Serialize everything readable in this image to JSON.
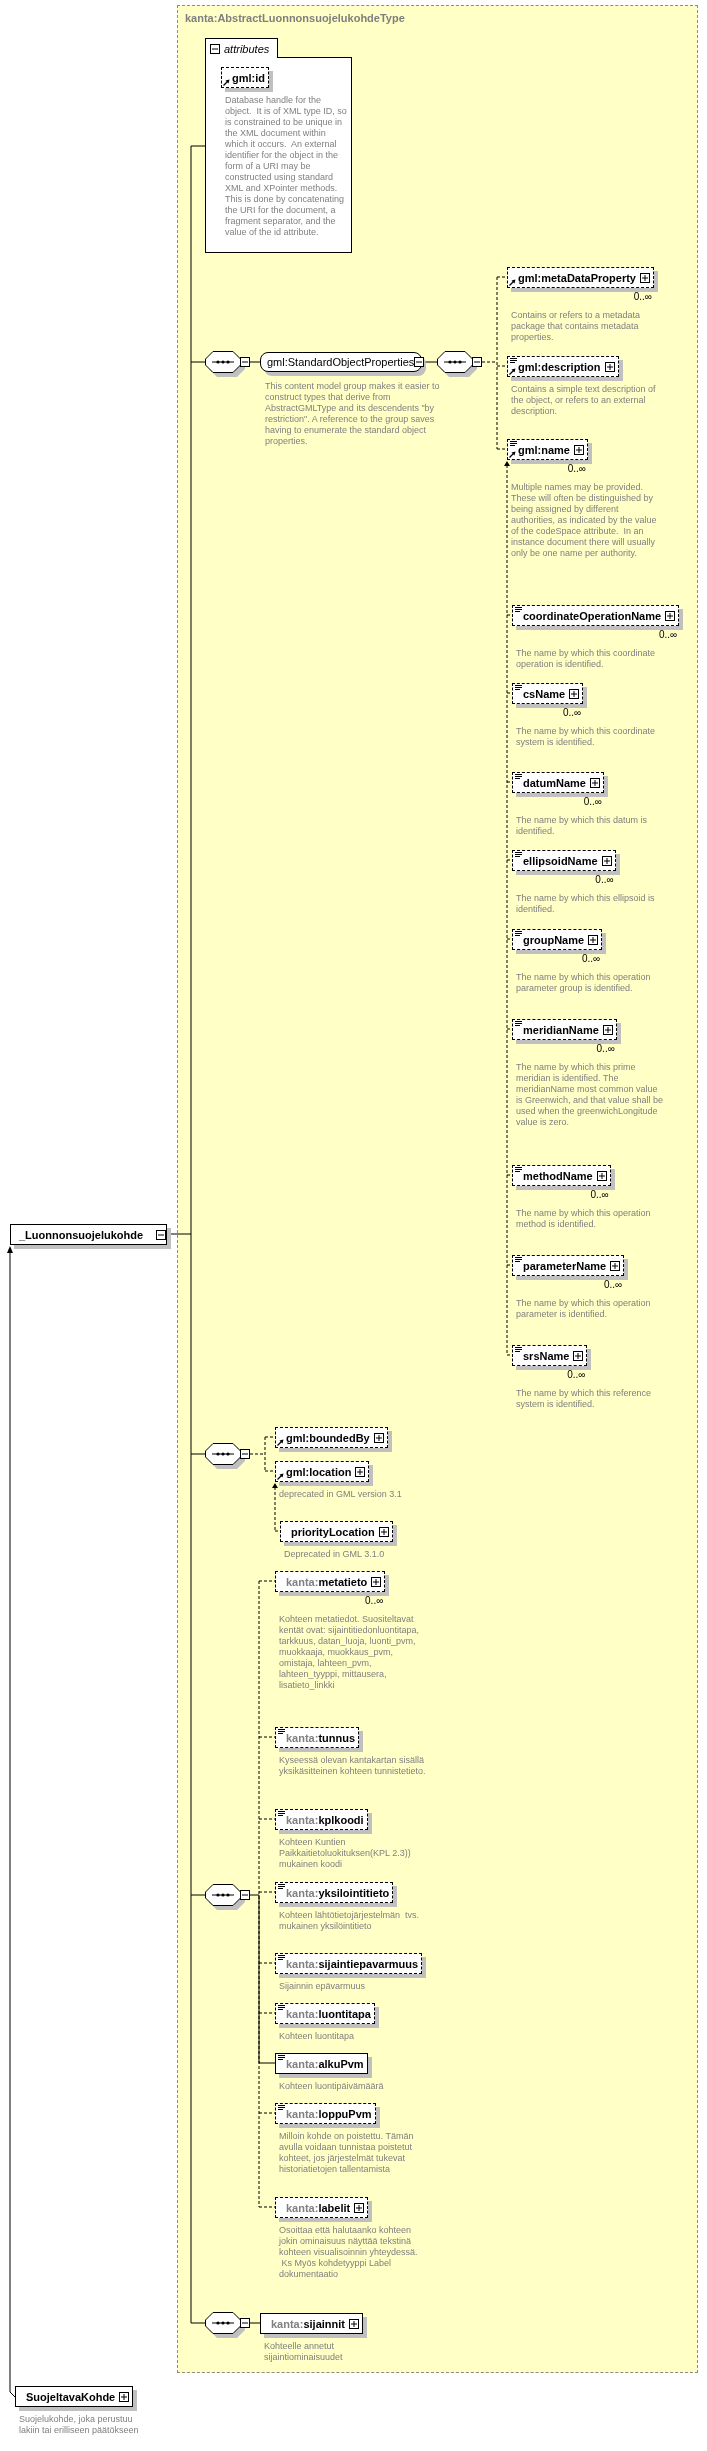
{
  "diagram_title": "kanta:AbstractLuonnonsuojelukohdeType",
  "attributes": {
    "label": "attributes",
    "expanded": true,
    "items": [
      {
        "name": "gml:id",
        "optional": true,
        "reference": true,
        "simple": false,
        "description": "Database handle for the object.  It is of XML type ID, so is constrained to be unique in the XML document within which it occurs.  An external identifier for the object in the form of a URI may be constructed using standard XML and XPointer methods.  This is done by concatenating the URI for the document, a fragment separator, and the value of the id attribute."
      }
    ]
  },
  "root": {
    "name": "_Luonnonsuojelukohde",
    "expanded": true
  },
  "groups": [
    {
      "kind": "group_ref",
      "expanded": true,
      "name": "gml:StandardObjectProperties",
      "name_expanded": true,
      "inner_expanded": true,
      "description": "This content model group makes it easier to construct types that derive from AbstractGMLType and its descendents \"by restriction\". A reference to the group saves having to enumerate the standard object properties.",
      "elements": [
        {
          "name": "gml:metaDataProperty",
          "optional": true,
          "reference": true,
          "simple": false,
          "expanded": false,
          "multiplicity": "0..∞",
          "description": "Contains or refers to a metadata package that contains metadata properties."
        },
        {
          "name": "gml:description",
          "optional": true,
          "reference": true,
          "simple": true,
          "expanded": false,
          "description": "Contains a simple text description of the object, or refers to an external description."
        },
        {
          "name": "gml:name",
          "optional": true,
          "reference": true,
          "simple": true,
          "expanded": false,
          "multiplicity": "0..∞",
          "description": "Multiple names may be provided.  These will often be distinguished by being assigned by different authorities, as indicated by the value of the codeSpace attribute.  In an instance document there will usually only be one name per authority.",
          "substitutes": [
            {
              "name": "coordinateOperationName",
              "optional": true,
              "reference": false,
              "simple": true,
              "expanded": false,
              "multiplicity": "0..∞",
              "description": "The name by which this coordinate operation is identified."
            },
            {
              "name": "csName",
              "optional": true,
              "reference": false,
              "simple": true,
              "expanded": false,
              "multiplicity": "0..∞",
              "description": "The name by which this coordinate system is identified."
            },
            {
              "name": "datumName",
              "optional": true,
              "reference": false,
              "simple": true,
              "expanded": false,
              "multiplicity": "0..∞",
              "description": "The name by which this datum is identified."
            },
            {
              "name": "ellipsoidName",
              "optional": true,
              "reference": false,
              "simple": true,
              "expanded": false,
              "multiplicity": "0..∞",
              "description": "The name by which this ellipsoid is identified."
            },
            {
              "name": "groupName",
              "optional": true,
              "reference": false,
              "simple": true,
              "expanded": false,
              "multiplicity": "0..∞",
              "description": "The name by which this operation parameter group is identified."
            },
            {
              "name": "meridianName",
              "optional": true,
              "reference": false,
              "simple": true,
              "expanded": false,
              "multiplicity": "0..∞",
              "description": "The name by which this prime meridian is identified. The meridianName most common value is Greenwich, and that value shall be used when the greenwichLongitude value is zero."
            },
            {
              "name": "methodName",
              "optional": true,
              "reference": false,
              "simple": true,
              "expanded": false,
              "multiplicity": "0..∞",
              "description": "The name by which this operation method is identified."
            },
            {
              "name": "parameterName",
              "optional": true,
              "reference": false,
              "simple": true,
              "expanded": false,
              "multiplicity": "0..∞",
              "description": "The name by which this operation parameter is identified."
            },
            {
              "name": "srsName",
              "optional": true,
              "reference": false,
              "simple": true,
              "expanded": false,
              "multiplicity": "0..∞",
              "description": "The name by which this reference system is identified."
            }
          ]
        }
      ]
    },
    {
      "kind": "sequence",
      "expanded": true,
      "elements": [
        {
          "name": "gml:boundedBy",
          "optional": true,
          "reference": true,
          "simple": false,
          "expanded": false
        },
        {
          "name": "gml:location",
          "optional": true,
          "reference": true,
          "simple": false,
          "expanded": false,
          "description": "deprecated in GML version 3.1",
          "substitutes": [
            {
              "name": "priorityLocation",
              "optional": true,
              "reference": false,
              "simple": false,
              "expanded": false,
              "description": "Deprecated in GML 3.1.0"
            }
          ]
        }
      ]
    },
    {
      "kind": "sequence",
      "expanded": true,
      "elements": [
        {
          "prefix": "kanta:",
          "name": "metatieto",
          "optional": true,
          "reference": false,
          "simple": false,
          "expanded": false,
          "multiplicity": "0..∞",
          "description": "Kohteen metatiedot. Suositeltavat kentät ovat: sijaintitiedonluontitapa, tarkkuus, datan_luoja, luonti_pvm, muokkaaja, muokkaus_pvm, omistaja, lahteen_pvm, lahteen_tyyppi, mittausera, lisatieto_linkki"
        },
        {
          "prefix": "kanta:",
          "name": "tunnus",
          "optional": true,
          "reference": false,
          "simple": true,
          "description": "Kyseessä olevan kantakartan sisällä yksikäsitteinen kohteen tunnistetieto."
        },
        {
          "prefix": "kanta:",
          "name": "kplkoodi",
          "optional": true,
          "reference": false,
          "simple": true,
          "description": "Kohteen Kuntien Paikkaitietoluokituksen(KPL 2.3)) mukainen koodi"
        },
        {
          "prefix": "kanta:",
          "name": "yksilointitieto",
          "optional": true,
          "reference": false,
          "simple": true,
          "description": "Kohteen lähtötietojärjestelmän  tvs. mukainen yksilöintitieto"
        },
        {
          "prefix": "kanta:",
          "name": "sijaintiepavarmuus",
          "optional": true,
          "reference": false,
          "simple": true,
          "description": "Sijainnin epävarmuus"
        },
        {
          "prefix": "kanta:",
          "name": "luontitapa",
          "optional": true,
          "reference": false,
          "simple": true,
          "description": "Kohteen luontitapa"
        },
        {
          "prefix": "kanta:",
          "name": "alkuPvm",
          "optional": false,
          "reference": false,
          "simple": true,
          "description": "Kohteen luontipäivämäärä"
        },
        {
          "prefix": "kanta:",
          "name": "loppuPvm",
          "optional": true,
          "reference": false,
          "simple": true,
          "description": "Milloin kohde on poistettu. Tämän avulla voidaan tunnistaa poistetut kohteet, jos järjestelmät tukevat historiatietojen tallentamista"
        },
        {
          "prefix": "kanta:",
          "name": "labelit",
          "optional": true,
          "reference": false,
          "simple": false,
          "expanded": false,
          "description": "Osoittaa että halutaanko kohteen jokin ominaisuus näyttää tekstinä kohteen visualisoinnin yhteydessä.\n Ks Myös kohdetyyppi Label dokumentaatio"
        }
      ]
    },
    {
      "kind": "sequence",
      "expanded": true,
      "elements": [
        {
          "prefix": "kanta:",
          "name": "sijainnit",
          "optional": false,
          "reference": false,
          "simple": false,
          "expanded": false,
          "description": "Kohteelle annetut sijaintiominaisuudet"
        }
      ]
    }
  ],
  "derived": {
    "name": "SuojeltavaKohde",
    "expanded": false,
    "description": "Suojelukohde, joka perustuu lakiin tai erilliseen päätökseen"
  }
}
